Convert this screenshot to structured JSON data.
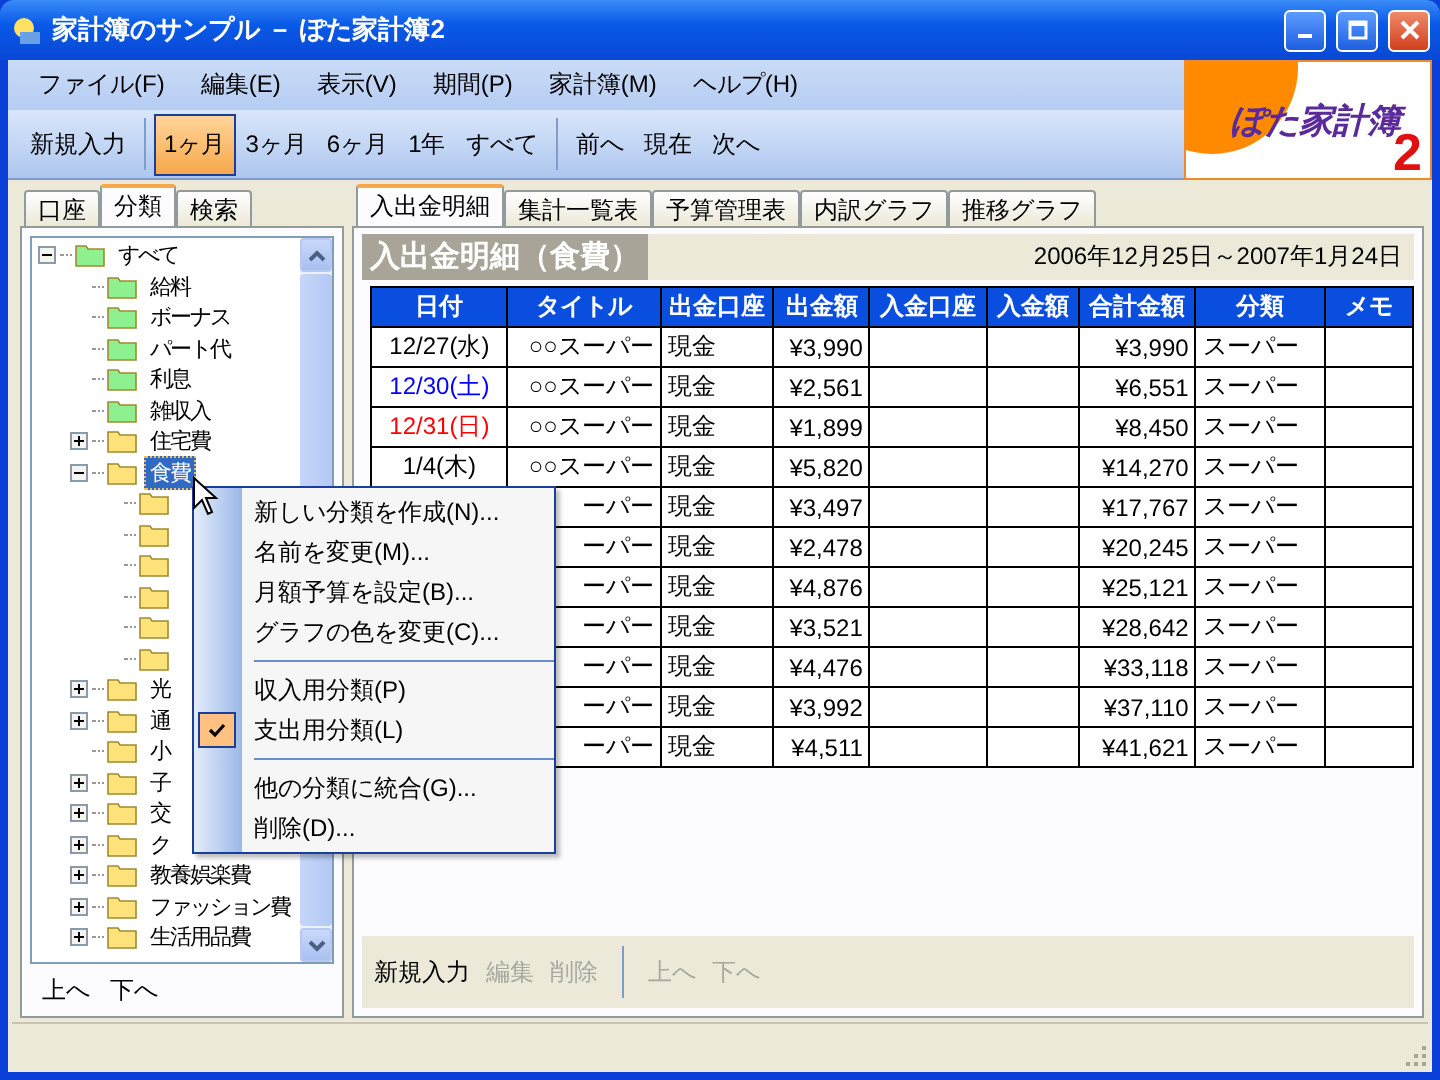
{
  "window": {
    "title": "家計簿のサンプル － ぽた家計簿2"
  },
  "menubar": [
    "ファイル(F)",
    "編集(E)",
    "表示(V)",
    "期間(P)",
    "家計簿(M)",
    "ヘルプ(H)"
  ],
  "toolbar": {
    "new_entry": "新規入力",
    "periods": [
      {
        "label": "1ヶ月",
        "selected": true
      },
      {
        "label": "3ヶ月",
        "selected": false
      },
      {
        "label": "6ヶ月",
        "selected": false
      },
      {
        "label": "1年",
        "selected": false
      },
      {
        "label": "すべて",
        "selected": false
      }
    ],
    "navigation": [
      "前へ",
      "現在",
      "次へ"
    ]
  },
  "logo": {
    "name": "ぽた家計簿",
    "version": "2"
  },
  "sidebar": {
    "tabs": [
      {
        "label": "口座",
        "selected": false
      },
      {
        "label": "分類",
        "selected": true
      },
      {
        "label": "検索",
        "selected": false
      }
    ],
    "tree": [
      {
        "label": "すべて",
        "kind": "income",
        "expanded": true,
        "selected": false,
        "children": [
          {
            "label": "給料",
            "kind": "income",
            "selected": false
          },
          {
            "label": "ボーナス",
            "kind": "income",
            "selected": false
          },
          {
            "label": "パート代",
            "kind": "income",
            "selected": false
          },
          {
            "label": "利息",
            "kind": "income",
            "selected": false
          },
          {
            "label": "雑収入",
            "kind": "income",
            "selected": false
          },
          {
            "label": "住宅費",
            "kind": "expense",
            "expanded": false,
            "selected": false
          },
          {
            "label": "食費",
            "kind": "expense",
            "expanded": true,
            "selected": true,
            "children": [
              {
                "kind": "expense",
                "selected": false
              },
              {
                "kind": "expense",
                "selected": false
              },
              {
                "kind": "expense",
                "selected": false
              },
              {
                "kind": "expense",
                "selected": false
              },
              {
                "kind": "expense",
                "selected": false
              },
              {
                "kind": "expense",
                "selected": false
              }
            ]
          },
          {
            "label": "光",
            "kind": "expense",
            "expanded": false,
            "selected": false
          },
          {
            "label": "通",
            "kind": "expense",
            "expanded": false,
            "selected": false
          },
          {
            "label": "小",
            "kind": "expense",
            "selected": false
          },
          {
            "label": "子",
            "kind": "expense",
            "expanded": false,
            "selected": false
          },
          {
            "label": "交",
            "kind": "expense",
            "expanded": false,
            "selected": false
          },
          {
            "label": "ク",
            "kind": "expense",
            "expanded": false,
            "selected": false
          },
          {
            "label": "教養娯楽費",
            "kind": "expense",
            "expanded": false,
            "selected": false
          },
          {
            "label": "ファッション費",
            "kind": "expense",
            "expanded": false,
            "selected": false
          },
          {
            "label": "生活用品費",
            "kind": "expense",
            "expanded": false,
            "selected": false
          }
        ]
      }
    ],
    "buttons": [
      "上へ",
      "下へ"
    ]
  },
  "main": {
    "tabs": [
      {
        "label": "入出金明細",
        "selected": true
      },
      {
        "label": "集計一覧表",
        "selected": false
      },
      {
        "label": "予算管理表",
        "selected": false
      },
      {
        "label": "内訳グラフ",
        "selected": false
      },
      {
        "label": "推移グラフ",
        "selected": false
      }
    ],
    "heading": "入出金明細（食費）",
    "period": "2006年12月25日～2007年1月24日",
    "table": {
      "columns": [
        "日付",
        "タイトル",
        "出金口座",
        "出金額",
        "入金口座",
        "入金額",
        "合計金額",
        "分類",
        "メモ"
      ],
      "rows": [
        {
          "date": "12/27(水)",
          "color": "#000000",
          "title": "○○スーパー",
          "out_account": "現金",
          "out_amount": "¥3,990",
          "total": "¥3,990",
          "category": "スーパー"
        },
        {
          "date": "12/30(土)",
          "color": "#0000ff",
          "title": "○○スーパー",
          "out_account": "現金",
          "out_amount": "¥2,561",
          "total": "¥6,551",
          "category": "スーパー"
        },
        {
          "date": "12/31(日)",
          "color": "#ff0000",
          "title": "○○スーパー",
          "out_account": "現金",
          "out_amount": "¥1,899",
          "total": "¥8,450",
          "category": "スーパー"
        },
        {
          "date": "1/4(木)",
          "color": "#000000",
          "title": "○○スーパー",
          "out_account": "現金",
          "out_amount": "¥5,820",
          "total": "¥14,270",
          "category": "スーパー"
        },
        {
          "title": "ーパー",
          "out_account": "現金",
          "out_amount": "¥3,497",
          "total": "¥17,767",
          "category": "スーパー"
        },
        {
          "title": "ーパー",
          "out_account": "現金",
          "out_amount": "¥2,478",
          "total": "¥20,245",
          "category": "スーパー"
        },
        {
          "title": "ーパー",
          "out_account": "現金",
          "out_amount": "¥4,876",
          "total": "¥25,121",
          "category": "スーパー"
        },
        {
          "title": "ーパー",
          "out_account": "現金",
          "out_amount": "¥3,521",
          "total": "¥28,642",
          "category": "スーパー"
        },
        {
          "title": "ーパー",
          "out_account": "現金",
          "out_amount": "¥4,476",
          "total": "¥33,118",
          "category": "スーパー"
        },
        {
          "title": "ーパー",
          "out_account": "現金",
          "out_amount": "¥3,992",
          "total": "¥37,110",
          "category": "スーパー"
        },
        {
          "title": "ーパー",
          "out_account": "現金",
          "out_amount": "¥4,511",
          "total": "¥41,621",
          "category": "スーパー"
        }
      ]
    },
    "bottom_toolbar": [
      {
        "label": "新規入力",
        "disabled": false
      },
      {
        "label": "編集",
        "disabled": true
      },
      {
        "label": "削除",
        "disabled": true
      },
      {
        "label": "上へ",
        "disabled": true
      },
      {
        "label": "下へ",
        "disabled": true
      }
    ]
  },
  "context_menu": [
    {
      "kind": "item",
      "label": "新しい分類を作成(N)...",
      "checked": false
    },
    {
      "kind": "item",
      "label": "名前を変更(M)...",
      "checked": false
    },
    {
      "kind": "item",
      "label": "月額予算を設定(B)...",
      "checked": false
    },
    {
      "kind": "item",
      "label": "グラフの色を変更(C)...",
      "checked": false
    },
    {
      "kind": "separator"
    },
    {
      "kind": "item",
      "label": "収入用分類(P)",
      "checked": false
    },
    {
      "kind": "item",
      "label": "支出用分類(L)",
      "checked": true
    },
    {
      "kind": "separator"
    },
    {
      "kind": "item",
      "label": "他の分類に統合(G)...",
      "checked": false
    },
    {
      "kind": "item",
      "label": "削除(D)...",
      "checked": false
    }
  ]
}
